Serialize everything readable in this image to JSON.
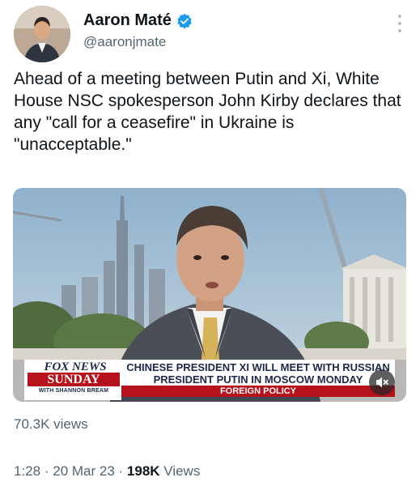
{
  "author": {
    "name": "Aaron Maté",
    "handle": "@aaronjmate",
    "verified": true
  },
  "tweet": {
    "text": "Ahead of a meeting between Putin and Xi, White House NSC spokesperson John Kirby declares that any \"call for a ceasefire\" in Ukraine is \"unacceptable.\""
  },
  "video": {
    "network": "FOX NEWS",
    "show": "SUNDAY",
    "host_line": "WITH SHANNON BREAM",
    "headline_line1": "CHINESE PRESIDENT XI WILL MEET WITH RUSSIAN",
    "headline_line2": "PRESIDENT PUTIN IN MOSCOW MONDAY",
    "segment": "FOREIGN POLICY",
    "mute_icon": "speaker-muted-icon"
  },
  "stats": {
    "video_views": "70.3K views",
    "time": "1:28",
    "separator": "·",
    "date": "20 Mar 23",
    "views_count": "198K",
    "views_label": "Views"
  },
  "colors": {
    "verified": "#1d9bf0",
    "secondary_text": "#536471",
    "primary_text": "#0f1419",
    "chyron_red": "#b5121b",
    "chyron_navy": "#1b2a49"
  }
}
